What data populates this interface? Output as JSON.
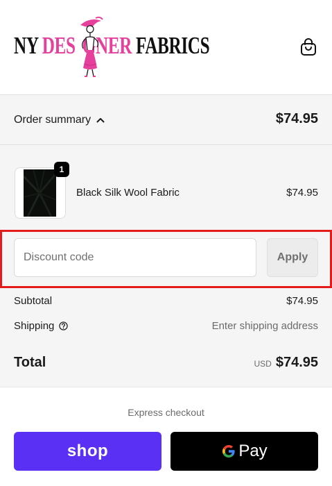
{
  "header": {
    "logo": {
      "word1": "NY",
      "word2": "DES",
      "word3": "GNER",
      "word4": "FABRICS",
      "colors": {
        "pink": "#e5419c",
        "dark": "#111111"
      }
    },
    "cart_icon": "shopping-bag-icon"
  },
  "summary": {
    "toggle_label": "Order summary",
    "toggle_icon": "chevron-up-icon",
    "total": "$74.95"
  },
  "line_item": {
    "name": "Black Silk Wool Fabric",
    "price": "$74.95",
    "quantity": "1"
  },
  "discount": {
    "placeholder": "Discount code",
    "apply_label": "Apply",
    "highlight_color": "#e31b1b"
  },
  "totals": {
    "subtotal_label": "Subtotal",
    "subtotal_value": "$74.95",
    "shipping_label": "Shipping",
    "shipping_icon": "help-circle-icon",
    "shipping_value": "Enter shipping address",
    "total_label": "Total",
    "currency": "USD",
    "total_value": "$74.95"
  },
  "express": {
    "label": "Express checkout",
    "shop_label": "shop",
    "gpay_g": "G",
    "gpay_label": "Pay",
    "shop_color": "#5a31f4"
  }
}
